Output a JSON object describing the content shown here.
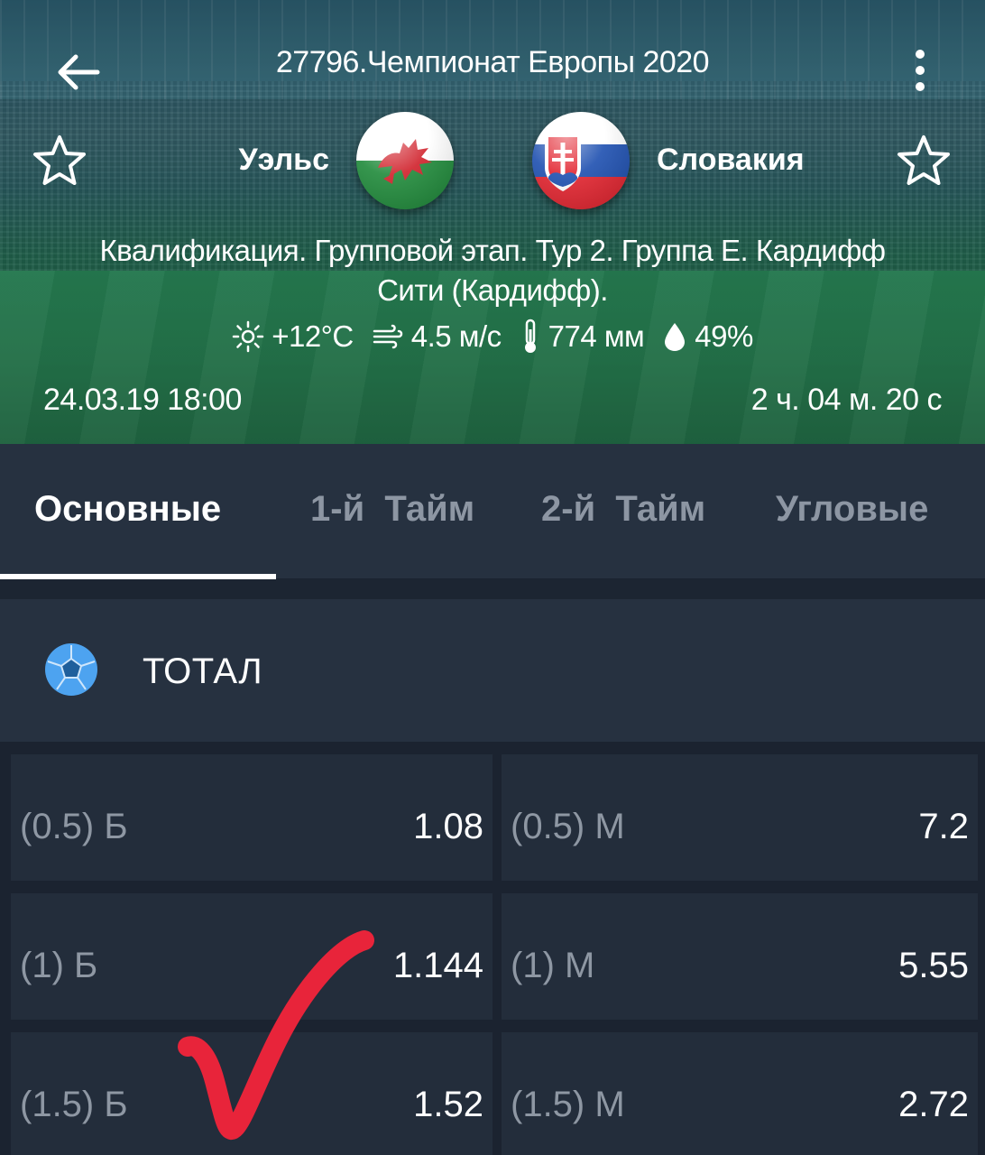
{
  "header": {
    "tournament": "27796.Чемпионат Европы 2020",
    "home_team": "Уэльс",
    "away_team": "Словакия",
    "event_info_line1": "Квалификация. Групповой этап. Тур 2. Группа Е. Кардифф",
    "event_info_line2": "Сити (Кардифф).",
    "weather": {
      "temperature": "+12°C",
      "wind": "4.5 м/с",
      "pressure": "774 мм",
      "humidity": "49%"
    },
    "date": "24.03.19 18:00",
    "countdown": "2 ч. 04 м. 20 с"
  },
  "tabs": [
    {
      "label": "Основные",
      "active": true
    },
    {
      "label": "1-й  Тайм",
      "active": false
    },
    {
      "label": "2-й  Тайм",
      "active": false
    },
    {
      "label": "Угловые",
      "active": false
    }
  ],
  "section": {
    "title": "ТОТАЛ",
    "icon": "soccer-ball-icon"
  },
  "odds": [
    {
      "over_label": "(0.5) Б",
      "over_value": "1.08",
      "under_label": "(0.5) М",
      "under_value": "7.2"
    },
    {
      "over_label": "(1) Б",
      "over_value": "1.144",
      "under_label": "(1) М",
      "under_value": "5.55"
    },
    {
      "over_label": "(1.5) Б",
      "over_value": "1.52",
      "under_label": "(1.5) М",
      "under_value": "2.72"
    }
  ],
  "colors": {
    "background": "#1f2836",
    "panel": "#263140",
    "cell": "#232d3b",
    "muted_text": "#8e97a3",
    "accent_blue": "#4da3f0",
    "checkmark": "#e8243a"
  }
}
